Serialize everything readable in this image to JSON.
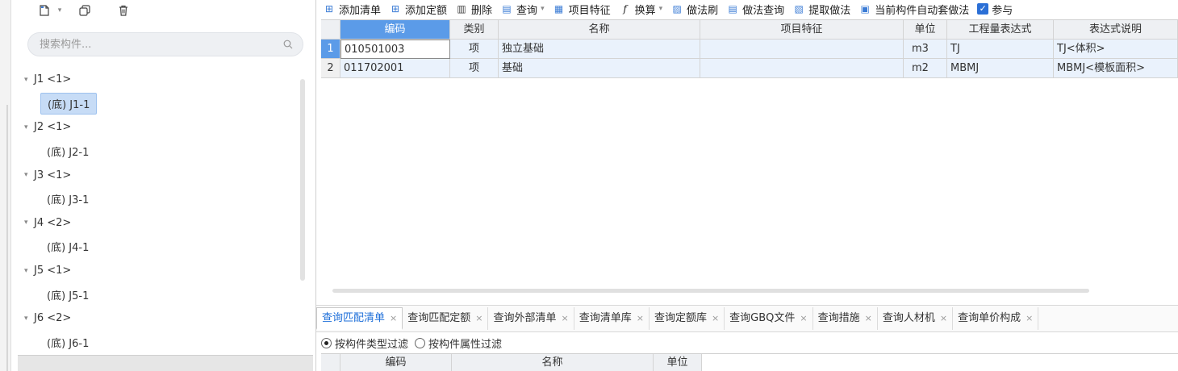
{
  "sidebar": {
    "search_placeholder": "搜索构件...",
    "tree": [
      {
        "type": "group",
        "label": "J1 <1>"
      },
      {
        "type": "leaf",
        "label": "(底) J1-1",
        "selected": true
      },
      {
        "type": "group",
        "label": "J2 <1>"
      },
      {
        "type": "leaf",
        "label": "(底) J2-1"
      },
      {
        "type": "group",
        "label": "J3 <1>"
      },
      {
        "type": "leaf",
        "label": "(底) J3-1"
      },
      {
        "type": "group",
        "label": "J4 <2>"
      },
      {
        "type": "leaf",
        "label": "(底) J4-1"
      },
      {
        "type": "group",
        "label": "J5 <1>"
      },
      {
        "type": "leaf",
        "label": "(底) J5-1"
      },
      {
        "type": "group",
        "label": "J6 <2>"
      },
      {
        "type": "leaf",
        "label": "(底) J6-1"
      }
    ]
  },
  "toolbar": {
    "add_list": "添加清单",
    "add_quota": "添加定额",
    "delete": "删除",
    "query": "查询",
    "item_features": "项目特征",
    "convert": "换算",
    "method_brush": "做法刷",
    "method_query": "做法查询",
    "extract_method": "提取做法",
    "auto_method": "当前构件自动套做法",
    "ref_partial": "参与"
  },
  "grid": {
    "columns": [
      "编码",
      "类别",
      "名称",
      "项目特征",
      "单位",
      "工程量表达式",
      "表达式说明"
    ],
    "rows": [
      {
        "num": "1",
        "code": "010501003",
        "category": "项",
        "name": "独立基础",
        "features": "",
        "unit": "m3",
        "expr": "TJ",
        "expr_desc": "TJ<体积>"
      },
      {
        "num": "2",
        "code": "011702001",
        "category": "项",
        "name": "基础",
        "features": "",
        "unit": "m2",
        "expr": "MBMJ",
        "expr_desc": "MBMJ<模板面积>"
      }
    ]
  },
  "tabs": [
    "查询匹配清单",
    "查询匹配定额",
    "查询外部清单",
    "查询清单库",
    "查询定额库",
    "查询GBQ文件",
    "查询措施",
    "查询人材机",
    "查询单价构成"
  ],
  "filter": {
    "by_type": "按构件类型过滤",
    "by_attr": "按构件属性过滤"
  },
  "bottom_grid": {
    "columns": [
      "编码",
      "名称",
      "单位"
    ]
  },
  "colors": {
    "selected_header": "#5b9be8",
    "row_bg": "#eaf2fc",
    "active_tab": "#1e6fd9"
  }
}
